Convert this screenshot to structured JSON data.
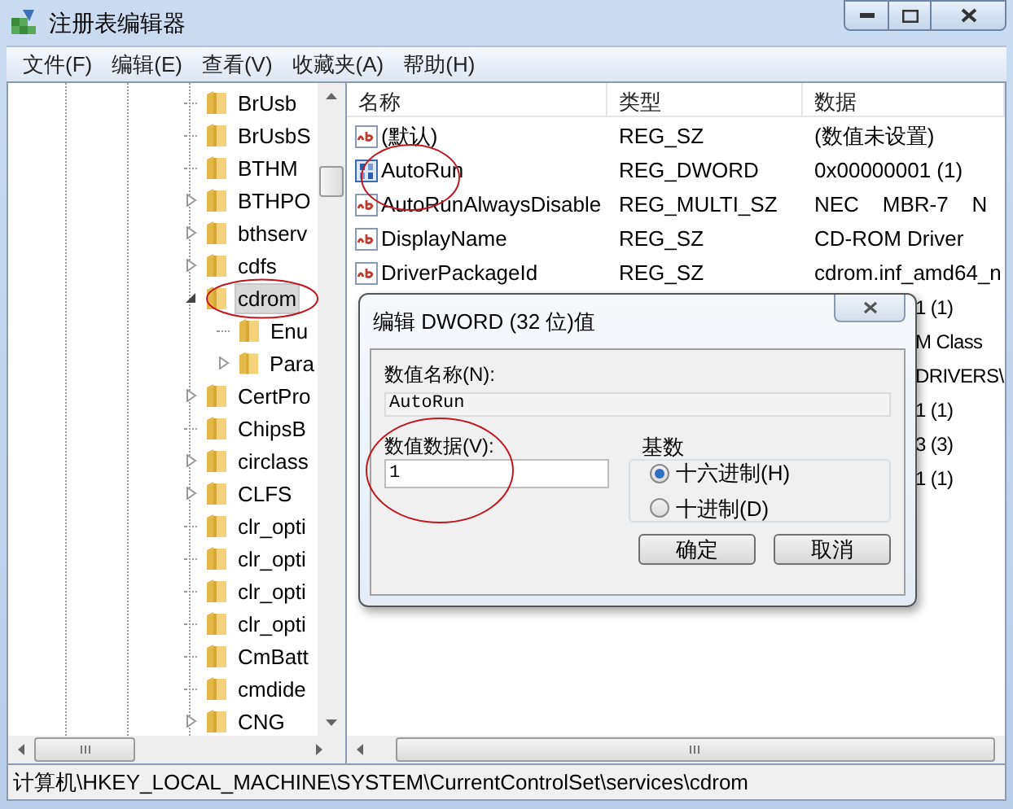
{
  "window": {
    "title": "注册表编辑器"
  },
  "menu": [
    {
      "label": "文件(F)"
    },
    {
      "label": "编辑(E)"
    },
    {
      "label": "查看(V)"
    },
    {
      "label": "收藏夹(A)"
    },
    {
      "label": "帮助(H)"
    }
  ],
  "tree": {
    "items": [
      {
        "kind": "leaf",
        "label": "BrUsb",
        "selected": false
      },
      {
        "kind": "leaf",
        "label": "BrUsbS",
        "selected": false
      },
      {
        "kind": "leaf",
        "label": "BTHM",
        "selected": false
      },
      {
        "kind": "collapsed",
        "label": "BTHPO",
        "selected": false
      },
      {
        "kind": "collapsed",
        "label": "bthserv",
        "selected": false
      },
      {
        "kind": "collapsed",
        "label": "cdfs",
        "selected": false
      },
      {
        "kind": "expanded",
        "label": "cdrom",
        "selected": true,
        "children": [
          {
            "kind": "leaf",
            "label": "Enu",
            "selected": false
          },
          {
            "kind": "collapsed",
            "label": "Para",
            "selected": false
          }
        ]
      },
      {
        "kind": "collapsed",
        "label": "CertPro",
        "selected": false
      },
      {
        "kind": "leaf",
        "label": "ChipsB",
        "selected": false
      },
      {
        "kind": "collapsed",
        "label": "circlass",
        "selected": false
      },
      {
        "kind": "collapsed",
        "label": "CLFS",
        "selected": false
      },
      {
        "kind": "leaf",
        "label": "clr_opti",
        "selected": false
      },
      {
        "kind": "leaf",
        "label": "clr_opti",
        "selected": false
      },
      {
        "kind": "leaf",
        "label": "clr_opti",
        "selected": false
      },
      {
        "kind": "leaf",
        "label": "clr_opti",
        "selected": false
      },
      {
        "kind": "leaf",
        "label": "CmBatt",
        "selected": false
      },
      {
        "kind": "leaf",
        "label": "cmdide",
        "selected": false
      },
      {
        "kind": "collapsed",
        "label": "CNG",
        "selected": false
      }
    ]
  },
  "list": {
    "columns": [
      "名称",
      "类型",
      "数据"
    ],
    "rows": [
      {
        "kind": "string",
        "name": "(默认)",
        "type": "REG_SZ",
        "data": "(数值未设置)"
      },
      {
        "kind": "number",
        "name": "AutoRun",
        "type": "REG_DWORD",
        "data": "0x00000001 (1)"
      },
      {
        "kind": "string",
        "name": "AutoRunAlwaysDisable",
        "type": "REG_MULTI_SZ",
        "data": "NEC    MBR-7    N"
      },
      {
        "kind": "string",
        "name": "DisplayName",
        "type": "REG_SZ",
        "data": "CD-ROM Driver"
      },
      {
        "kind": "string",
        "name": "DriverPackageId",
        "type": "REG_SZ",
        "data": "cdrom.inf_amd64_n"
      },
      {
        "kind": "covered",
        "data": "1 (1)"
      },
      {
        "kind": "covered",
        "data": "M Class"
      },
      {
        "kind": "covered",
        "data": "DRIVERS\\"
      },
      {
        "kind": "covered",
        "data": "1 (1)"
      },
      {
        "kind": "covered",
        "data": "3 (3)"
      },
      {
        "kind": "covered",
        "data": "1 (1)"
      }
    ]
  },
  "status_bar": "计算机\\HKEY_LOCAL_MACHINE\\SYSTEM\\CurrentControlSet\\services\\cdrom",
  "dialog": {
    "title": "编辑 DWORD (32 位)值",
    "name_label": "数值名称(N):",
    "name_value": "AutoRun",
    "data_label": "数值数据(V):",
    "data_value": "1",
    "base_label": "基数",
    "radios": [
      {
        "label": "十六进制(H)",
        "selected": true
      },
      {
        "label": "十进制(D)",
        "selected": false
      }
    ],
    "buttons": [
      "确定",
      "取消"
    ]
  }
}
